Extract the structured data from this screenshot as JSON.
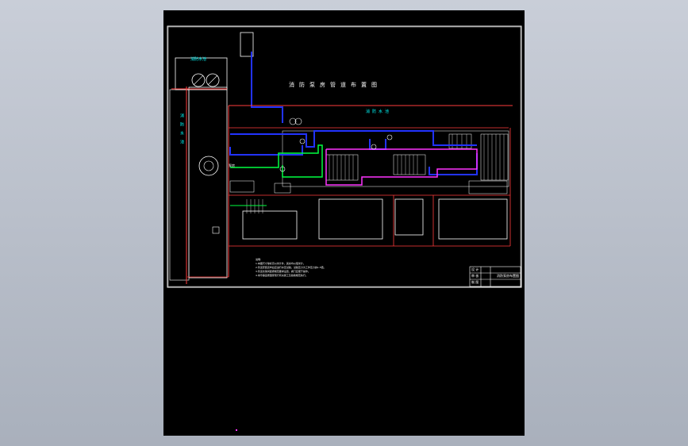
{
  "drawing": {
    "title": "消防泵房管道布置图",
    "hydrant_label_top": "消防水池",
    "hydrant_label_right": "消防水池",
    "side_label": "消防水池",
    "pump_tag": "泵房",
    "notes_header": "说明:",
    "notes": [
      "1.本图尺寸除标高以米计外，其余均以毫米计。",
      "2.管道安装完毕后应进行水压试验，试验压力为工作压力的1.5倍。",
      "3.管道支架间距按规范要求设置，阀门应便于操作。",
      "4.未尽事宜按国家现行有关施工及验收规范执行。"
    ],
    "title_block": {
      "rows": [
        "设 计",
        "审 核",
        "制 图"
      ],
      "drawing_name": "消防泵房布置图"
    }
  },
  "colors": {
    "background": "#000000",
    "frame": "#ffffff",
    "wall": "#ff3b3b",
    "pipe_main": "#2233ff",
    "pipe_secondary": "#00ff40",
    "pipe_tertiary": "#ff33ff",
    "text_cyan": "#00ffff"
  }
}
